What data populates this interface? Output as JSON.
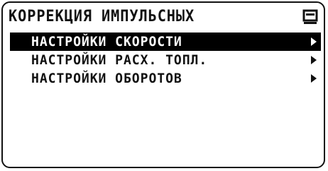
{
  "header": {
    "title": "КОРРЕКЦИЯ ИМПУЛЬСНЫХ",
    "icon": "menu-list-icon"
  },
  "menu": {
    "items": [
      {
        "label": "НАСТРОЙКИ СКОРОСТИ",
        "selected": true,
        "icon": "arrow-right-icon"
      },
      {
        "label": "НАСТРОЙКИ РАСХ. ТОПЛ.",
        "selected": false,
        "icon": "arrow-right-icon"
      },
      {
        "label": "НАСТРОЙКИ ОБОРОТОВ",
        "selected": false,
        "icon": "arrow-right-icon"
      }
    ]
  },
  "colors": {
    "foreground": "#111111",
    "background": "#ffffff",
    "selection": "#000000"
  }
}
